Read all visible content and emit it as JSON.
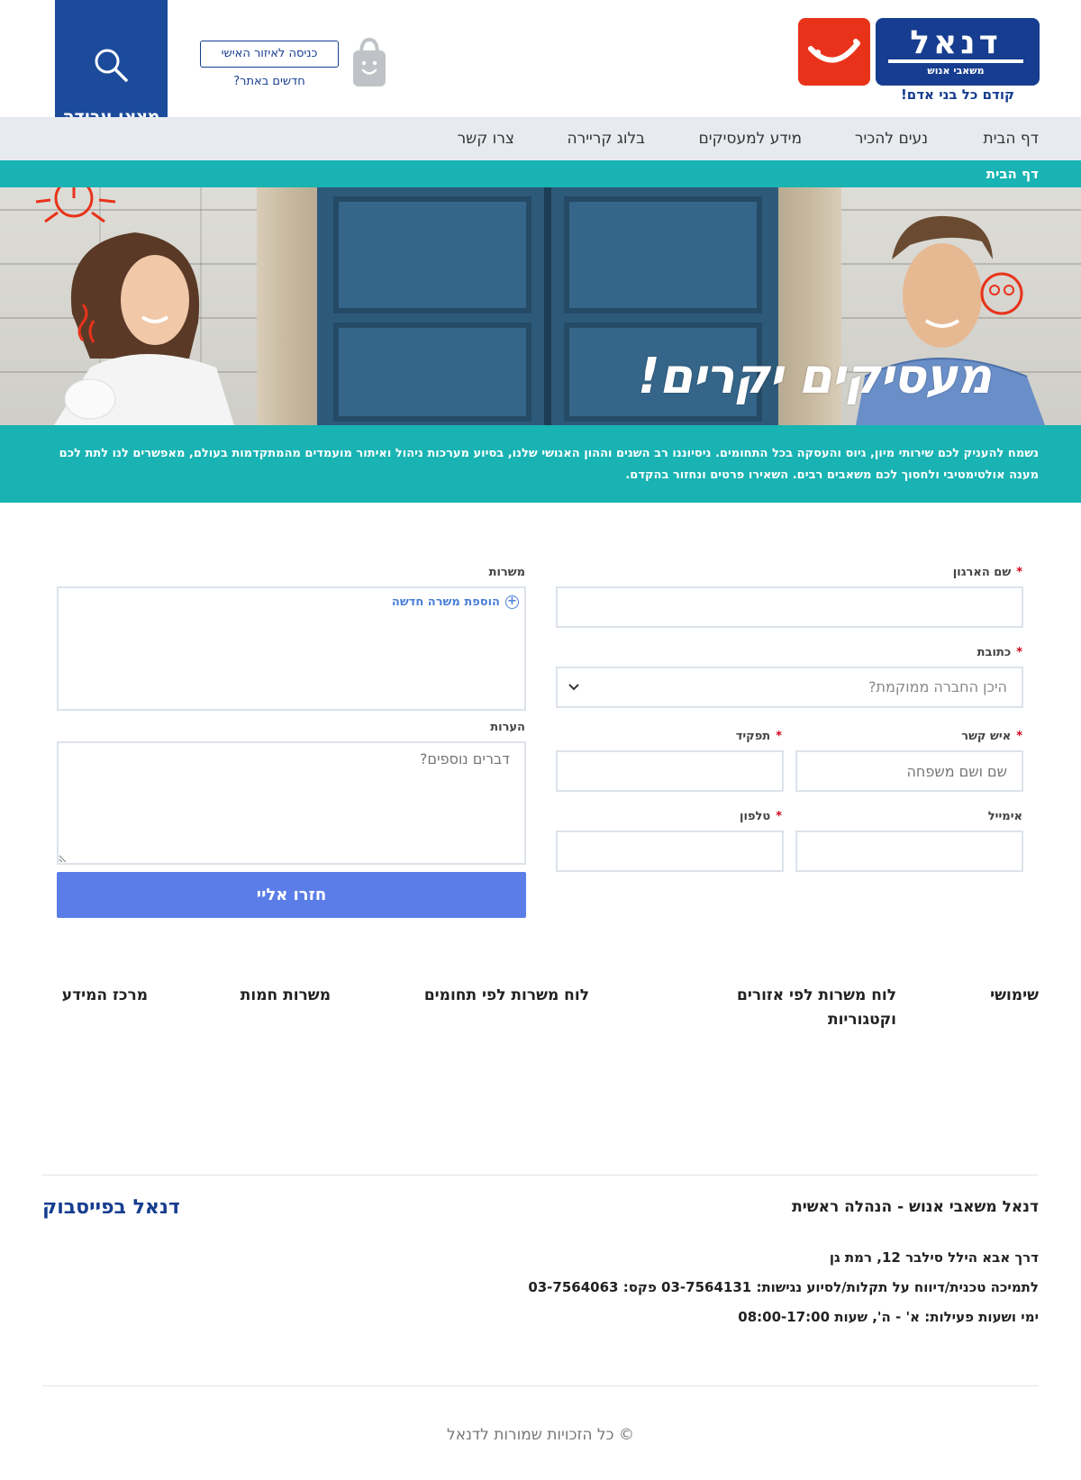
{
  "header": {
    "logo": {
      "name": "דנאל",
      "sub": "משאבי אנוש",
      "slogan": "קודם כל בני אדם!"
    },
    "personal_area_label": "כניסה לאיזור האישי",
    "new_link": "חדשים באתר?",
    "find_job_label": "מצאו עבודה",
    "icons": {
      "bag": "shopping-bag-icon",
      "search": "search-icon"
    },
    "colors": {
      "brand_blue": "#163d8f",
      "brand_red": "#e8331a",
      "teal": "#19b3b3",
      "button_blue": "#5b7de8"
    }
  },
  "nav": {
    "items": [
      {
        "label": "דף הבית"
      },
      {
        "label": "נעים להכיר"
      },
      {
        "label": "מידע למעסיקים"
      },
      {
        "label": "בלוג קריירה"
      },
      {
        "label": "צרו קשר"
      }
    ]
  },
  "breadcrumb": "דף הבית",
  "hero": {
    "title": "מעסיקים יקרים!"
  },
  "intro": "נשמח להעניק לכם שירותי מיון, גיוס והעסקה בכל התחומים. ניסיוננו רב השנים וההון האנושי שלנו, בסיוע מערכות ניהול ואיתור מועמדים מהמתקדמות בעולם, מאפשרים לנו לתת לכם מענה אולטימטיבי ולחסוך לכם משאבים רבים. השאירו פרטים ונחזור בהקדם.",
  "form": {
    "org_name_label": "שם הארגון",
    "address_label": "כתובת",
    "address_placeholder": "היכן החברה ממוקמת?",
    "contact_label": "איש קשר",
    "contact_placeholder": "שם ושם משפחה",
    "role_label": "תפקיד",
    "email_label": "אימייל",
    "phone_label": "טלפון",
    "positions_label": "משרות",
    "add_position": "הוספת משרה חדשה",
    "notes_label": "הערות",
    "notes_placeholder": "דברים נוספים?",
    "submit": "חזרו אליי",
    "required_mark": "*"
  },
  "footer_links": [
    "שימושי",
    "לוח משרות לפי אזורים וקטגוריות",
    "לוח משרות לפי תחומים",
    "משרות חמות",
    "מרכז המידע"
  ],
  "contact": {
    "title": "דנאל משאבי אנוש - הנהלה ראשית",
    "facebook": "דנאל בפייסבוק",
    "address": "דרך אבא הילל סילבר 12, רמת גן",
    "support": "לתמיכה טכנית/דיווח על תקלות/לסיוע נגישות: 03-7564131 פקס: 03-7564063",
    "hours": "ימי ושעות פעילות: א' - ה', שעות 08:00-17:00"
  },
  "copyright": "© כל הזכויות שמורות לדנאל"
}
